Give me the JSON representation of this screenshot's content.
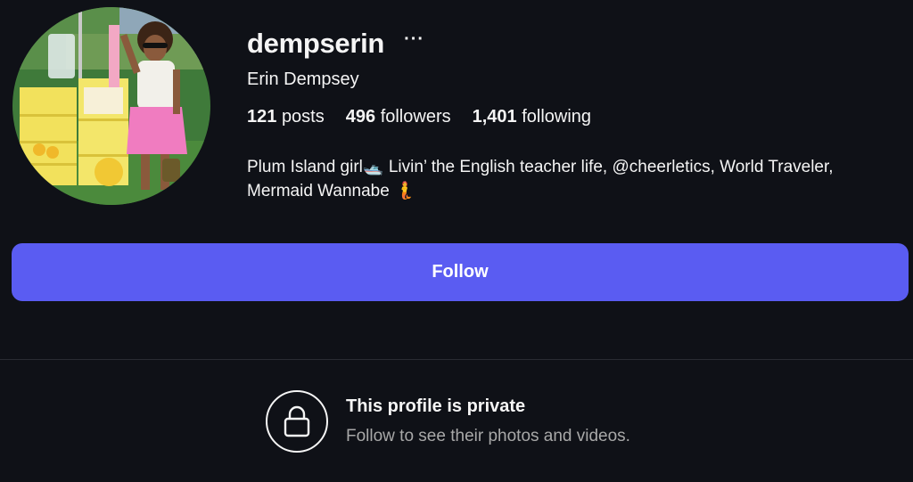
{
  "profile": {
    "username": "dempserin",
    "more_options": "···",
    "full_name": "Erin Dempsey",
    "stats": {
      "posts_count": "121",
      "posts_label": "posts",
      "followers_count": "496",
      "followers_label": "followers",
      "following_count": "1,401",
      "following_label": "following"
    },
    "bio_line1": "Plum Island girl🛥️ Livin’ the English teacher life, @cheerletics, World Traveler,",
    "bio_line2": "Mermaid Wannabe 🧜"
  },
  "actions": {
    "follow_label": "Follow"
  },
  "private_notice": {
    "title": "This profile is private",
    "subtitle": "Follow to see their photos and videos."
  },
  "colors": {
    "background": "#0f1117",
    "follow_button": "#5a5cf2",
    "primary_text": "#f5f5f5",
    "secondary_text": "#a8a8a8"
  },
  "icons": {
    "more": "more-options-icon",
    "lock": "lock-icon"
  }
}
